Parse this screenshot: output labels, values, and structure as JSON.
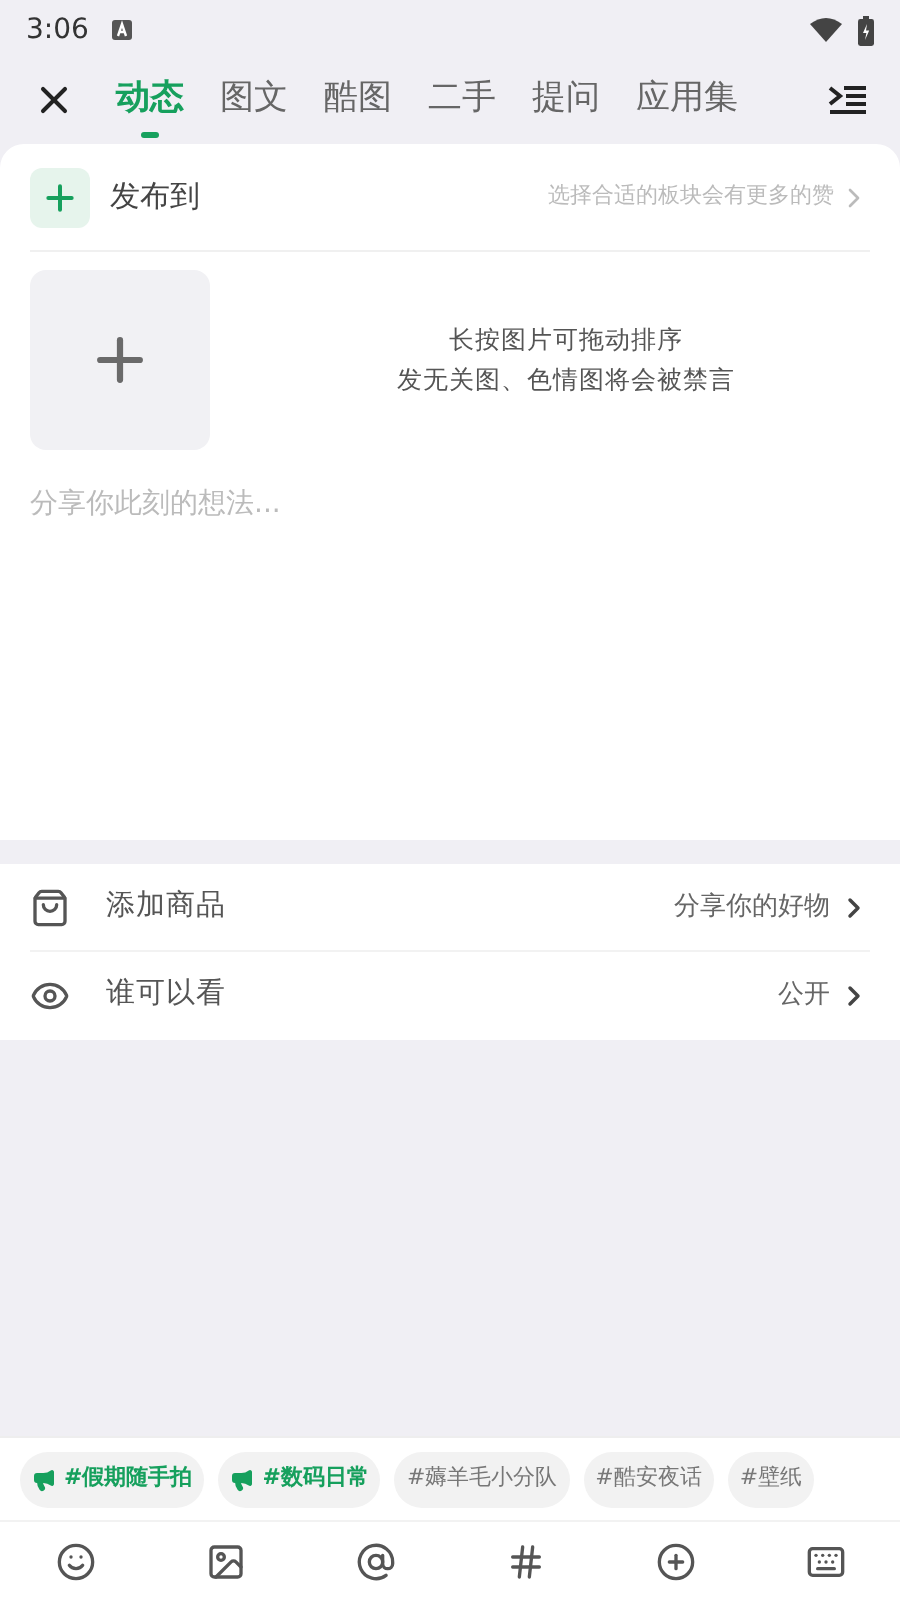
{
  "status_bar": {
    "time": "3:06"
  },
  "tabs": [
    {
      "label": "动态",
      "selected": true
    },
    {
      "label": "图文",
      "selected": false
    },
    {
      "label": "酷图",
      "selected": false
    },
    {
      "label": "二手",
      "selected": false
    },
    {
      "label": "提问",
      "selected": false
    },
    {
      "label": "应用集",
      "selected": false
    }
  ],
  "publish_to": {
    "label": "发布到",
    "hint": "选择合适的板块会有更多的赞"
  },
  "image_hint": [
    "长按图片可拖动排序",
    "发无关图、色情图将会被禁言"
  ],
  "post": {
    "placeholder": "分享你此刻的想法..."
  },
  "options": [
    {
      "kind": "goods",
      "label": "添加商品",
      "value": "分享你的好物"
    },
    {
      "kind": "visibility",
      "label": "谁可以看",
      "value": "公开"
    }
  ],
  "topics": [
    {
      "kind": "promoted",
      "label": "#假期随手拍"
    },
    {
      "kind": "promoted",
      "label": "#数码日常"
    },
    {
      "kind": "plain",
      "label": "#薅羊毛小分队"
    },
    {
      "kind": "plain",
      "label": "#酷安夜话"
    },
    {
      "kind": "plain",
      "label": "#壁纸"
    }
  ]
}
